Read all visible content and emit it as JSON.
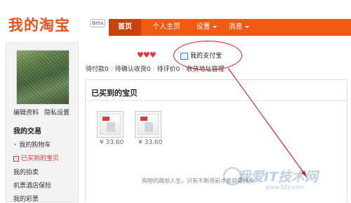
{
  "logo": {
    "text": "我的淘宝",
    "badge": "Beta"
  },
  "nav": {
    "items": [
      "首页",
      "个人主页",
      "设置",
      "消息"
    ]
  },
  "sidebar": {
    "edit_profile": "编辑资料",
    "privacy": "隐私设置",
    "section_title": "我的交易",
    "items": [
      "我的购物车",
      "已买到的宝贝",
      "我的拍卖",
      "机票酒店保险",
      "我的彩票"
    ]
  },
  "alipay": {
    "label": "我的支付宝"
  },
  "status": {
    "pending_pay": "待付款0",
    "pending_confirm": "待确认收货0",
    "pending_review": "待评价0",
    "address": "收货地址管理"
  },
  "bought": {
    "title": "已买到的宝贝",
    "items": [
      {
        "price": "¥ 33.60"
      },
      {
        "price": "¥ 33.60"
      }
    ]
  },
  "slogan": "购物的路加人生，只有不断将前才能获得快乐",
  "watermark": {
    "text": "我爱IT技术网",
    "url": "www.52ij.com"
  },
  "colors": {
    "brand": "#f15a13",
    "annotation": "#d21f1f"
  }
}
